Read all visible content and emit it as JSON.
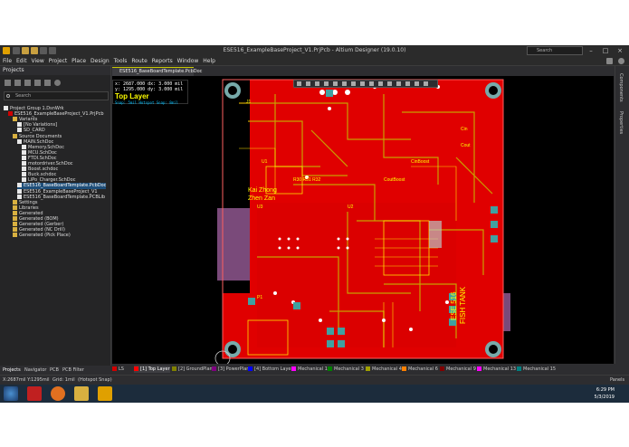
{
  "window": {
    "title": "ESE516_ExampleBaseProject_V1.PrjPcb - Altium Designer (19.0.10)",
    "search_placeholder": "Search"
  },
  "menu": [
    "File",
    "Edit",
    "View",
    "Project",
    "Place",
    "Design",
    "Tools",
    "Route",
    "Reports",
    "Window",
    "Help"
  ],
  "projects_panel": {
    "title": "Projects",
    "search_placeholder": "Search",
    "tree": [
      {
        "label": "Project Group 1.DsnWrk",
        "level": 0
      },
      {
        "label": "ESE516_ExampleBaseProject_V1.PrjPcb",
        "level": 1
      },
      {
        "label": "Variants",
        "level": 2
      },
      {
        "label": "[No Variations]",
        "level": 3
      },
      {
        "label": "SD_CARD",
        "level": 3
      },
      {
        "label": "Source Documents",
        "level": 2
      },
      {
        "label": "MAIN.SchDoc",
        "level": 3
      },
      {
        "label": "Memory.SchDoc",
        "level": 4
      },
      {
        "label": "MCU.SchDoc",
        "level": 4
      },
      {
        "label": "FTDI.SchDoc",
        "level": 4
      },
      {
        "label": "motordriver.SchDoc",
        "level": 4
      },
      {
        "label": "Boost.schdoc",
        "level": 4
      },
      {
        "label": "Buck.schdoc",
        "level": 4
      },
      {
        "label": "LiPo_Charger.SchDoc",
        "level": 4
      },
      {
        "label": "ESE516_BaseBoardTemplate.PcbDoc",
        "level": 3
      },
      {
        "label": "ESE516_ExampleBaseProject_V1",
        "level": 3
      },
      {
        "label": "ESE516_BaseBoardTemplate.PCBLib",
        "level": 3
      },
      {
        "label": "Settings",
        "level": 2
      },
      {
        "label": "Libraries",
        "level": 2
      },
      {
        "label": "Generated",
        "level": 2
      },
      {
        "label": "Generated (BOM)",
        "level": 2
      },
      {
        "label": "Generated (Gerber)",
        "level": 2
      },
      {
        "label": "Generated (NC Drill)",
        "level": 2
      },
      {
        "label": "Generated (Pick Place)",
        "level": 2
      }
    ],
    "bottom_tabs": [
      "Projects",
      "Navigator",
      "PCB",
      "PCB Filter"
    ]
  },
  "document_tab": "ESE516_BaseBoardTemplate.PcbDoc",
  "readout": {
    "x": "x:  2687.000",
    "dx": "dx:    3.000 mil",
    "y": "y:  1295.000",
    "dy": "dy:    3.000 mil",
    "layer": "Top Layer",
    "snap": "Snap: 5mil Hotspot Snap: 8mil"
  },
  "board_labels": {
    "name1": "Kai Zhong",
    "name2": "Zhen Zan",
    "tank1": "ESE 516",
    "tank2": "FISH TANK",
    "ref_j1": "J1",
    "ref_u1": "U1",
    "ref_u3": "U3",
    "ref_u2": "U2",
    "ref_p1": "P1",
    "ref_r30": "R30 R31 R32",
    "ref_cout": "CoutBoost",
    "ref_cin": "CinBoost",
    "ref_cout2": "Cout",
    "ref_cin2": "Cin"
  },
  "side_tabs": [
    "Components",
    "Properties"
  ],
  "layers": [
    {
      "label": "LS",
      "color": "#d00000"
    },
    {
      "label": "[1] Top Layer",
      "color": "#ff0000"
    },
    {
      "label": "[2] GroundPlane",
      "color": "#808000"
    },
    {
      "label": "[3] PowerPlane",
      "color": "#800080"
    },
    {
      "label": "[4] Bottom Layer",
      "color": "#0000ff"
    },
    {
      "label": "Mechanical 1",
      "color": "#ff00ff"
    },
    {
      "label": "Mechanical 3",
      "color": "#008000"
    },
    {
      "label": "Mechanical 4",
      "color": "#a0a000"
    },
    {
      "label": "Mechanical 6",
      "color": "#ff8000"
    },
    {
      "label": "Mechanical 9",
      "color": "#800000"
    },
    {
      "label": "Mechanical 13",
      "color": "#ff00ff"
    },
    {
      "label": "Mechanical 15",
      "color": "#008080"
    }
  ],
  "status": {
    "coords": "X:2687mil Y:1295mil",
    "grid": "Grid: 1mil",
    "snap": "(Hotspot Snap)",
    "panels": "Panels"
  },
  "taskbar": {
    "time": "6:29 PM",
    "date": "5/3/2019"
  }
}
